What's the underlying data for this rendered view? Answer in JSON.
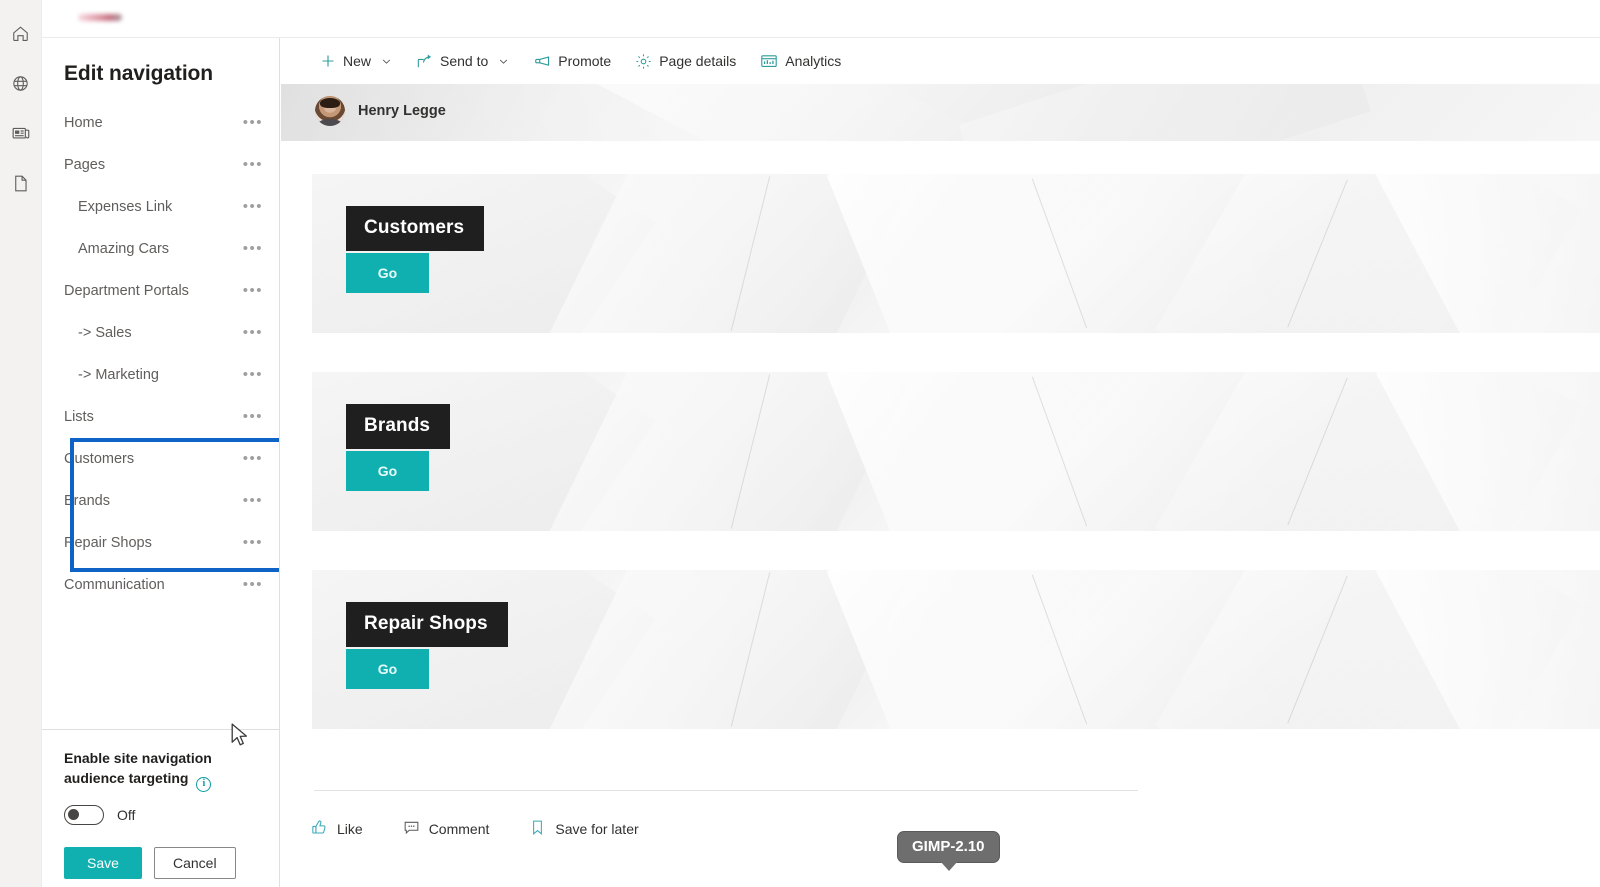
{
  "app_rail": {
    "items": [
      {
        "name": "home-icon",
        "label": "Home"
      },
      {
        "name": "globe-icon",
        "label": "Global navigation"
      },
      {
        "name": "news-icon",
        "label": "News"
      },
      {
        "name": "documents-icon",
        "label": "Documents"
      }
    ]
  },
  "brand": {
    "logo_alt": "site-logo"
  },
  "nav_panel": {
    "title": "Edit navigation",
    "items": [
      {
        "label": "Home",
        "level": 0
      },
      {
        "label": "Pages",
        "level": 0
      },
      {
        "label": "Expenses Link",
        "level": 1
      },
      {
        "label": "Amazing Cars",
        "level": 1
      },
      {
        "label": "Department Portals",
        "level": 0
      },
      {
        "label": "-> Sales",
        "level": 1
      },
      {
        "label": "-> Marketing",
        "level": 1
      },
      {
        "label": "Lists",
        "level": 0
      },
      {
        "label": "Customers",
        "level": 0
      },
      {
        "label": "Brands",
        "level": 0
      },
      {
        "label": "Repair Shops",
        "level": 0
      },
      {
        "label": "Communication",
        "level": 0
      }
    ],
    "ellipsis_glyph": "•••",
    "annotation": {
      "color": "#1063C6",
      "covers": [
        "Customers",
        "Brands",
        "Repair Shops"
      ]
    },
    "footer": {
      "audience_label": "Enable site navigation audience targeting",
      "info_glyph": "i",
      "toggle_state": "Off",
      "save_label": "Save",
      "cancel_label": "Cancel",
      "primary_color": "#11b0b0"
    }
  },
  "command_bar": {
    "items": [
      {
        "label": "New",
        "icon": "plus-icon",
        "has_chevron": true
      },
      {
        "label": "Send to",
        "icon": "share-icon",
        "has_chevron": true
      },
      {
        "label": "Promote",
        "icon": "megaphone-icon",
        "has_chevron": false
      },
      {
        "label": "Page details",
        "icon": "gear-icon",
        "has_chevron": false
      },
      {
        "label": "Analytics",
        "icon": "analytics-icon",
        "has_chevron": false
      }
    ]
  },
  "page_header": {
    "author_name": "Henry Legge"
  },
  "cards": [
    {
      "title": "Customers",
      "button_label": "Go"
    },
    {
      "title": "Brands",
      "button_label": "Go"
    },
    {
      "title": "Repair Shops",
      "button_label": "Go"
    }
  ],
  "social_bar": {
    "items": [
      {
        "label": "Like",
        "icon": "thumbs-up-icon"
      },
      {
        "label": "Comment",
        "icon": "comment-icon"
      },
      {
        "label": "Save for later",
        "icon": "bookmark-icon"
      }
    ]
  },
  "tooltip": {
    "text": "GIMP-2.10"
  }
}
